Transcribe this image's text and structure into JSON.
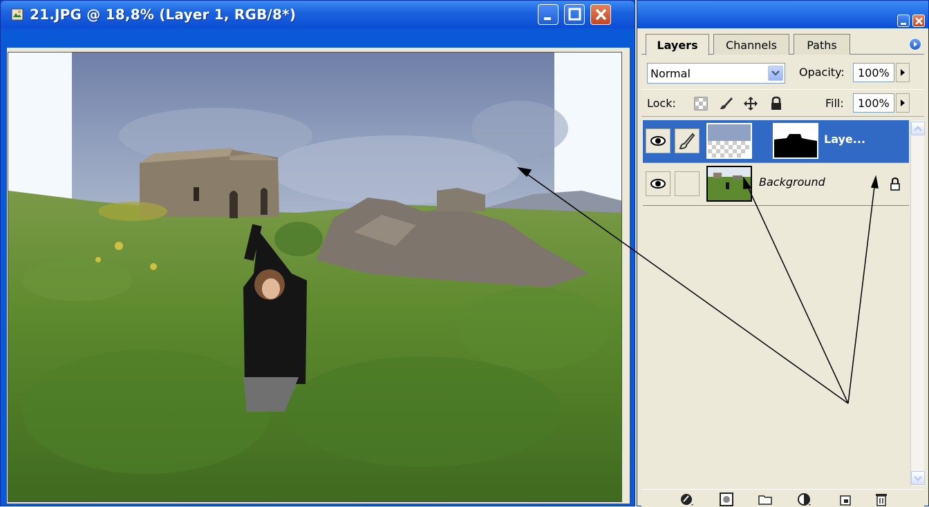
{
  "document": {
    "title": "21.JPG @ 18,8% (Layer 1, RGB/8*)",
    "icons": {
      "app": "photoshop-doc-icon",
      "minimize": "minimize-icon",
      "maximize": "maximize-icon",
      "close": "close-icon"
    }
  },
  "palette": {
    "tabs": [
      {
        "label": "Layers",
        "active": true
      },
      {
        "label": "Channels",
        "active": false
      },
      {
        "label": "Paths",
        "active": false
      }
    ],
    "blend_mode": "Normal",
    "opacity_label": "Opacity:",
    "opacity_value": "100%",
    "lock_label": "Lock:",
    "fill_label": "Fill:",
    "fill_value": "100%",
    "layers": [
      {
        "name": "Laye...",
        "selected": true,
        "visible": true,
        "has_mask": true
      },
      {
        "name": "Background",
        "selected": false,
        "visible": true,
        "locked": true
      }
    ],
    "bottom_icons": [
      "add-layer-style-icon",
      "add-mask-icon",
      "new-group-icon",
      "adjustment-layer-icon",
      "new-layer-icon",
      "trash-icon"
    ]
  },
  "colors": {
    "titlebar": "#0a4dd4",
    "selection": "#316ac5",
    "close_button": "#c8451d"
  }
}
